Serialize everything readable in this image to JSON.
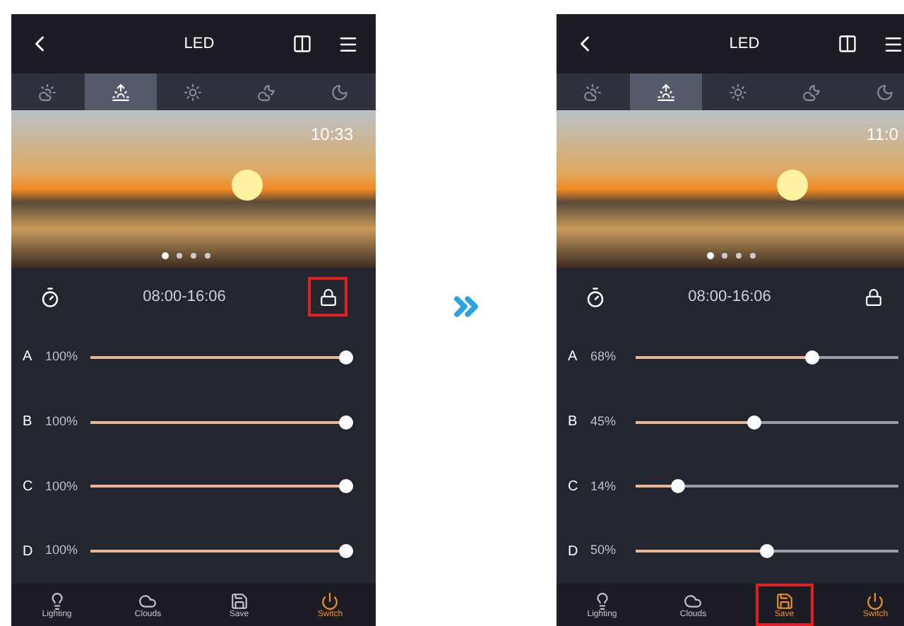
{
  "phones": [
    {
      "title": "LED",
      "modes": [
        {
          "kind": "cloud-sun",
          "selected": false
        },
        {
          "kind": "sunrise",
          "selected": true
        },
        {
          "kind": "sun",
          "selected": false
        },
        {
          "kind": "cloud-moon",
          "selected": false
        },
        {
          "kind": "moon",
          "selected": false
        }
      ],
      "clock": "10:33",
      "schedule": "08:00-16:06",
      "lock_highlighted": true,
      "channels": [
        {
          "name": "A",
          "reading": "100%",
          "level": 1
        },
        {
          "name": "B",
          "reading": "100%",
          "level": 1
        },
        {
          "name": "C",
          "reading": "100%",
          "level": 1
        },
        {
          "name": "D",
          "reading": "100%",
          "level": 1
        }
      ],
      "nav": [
        {
          "kind": "lighting",
          "label": "Lighting",
          "active": false,
          "highlighted": false
        },
        {
          "kind": "clouds",
          "label": "Clouds",
          "active": false,
          "highlighted": false
        },
        {
          "kind": "save",
          "label": "Save",
          "active": false,
          "highlighted": false
        },
        {
          "kind": "switch",
          "label": "Switch",
          "active": true,
          "highlighted": false
        }
      ]
    },
    {
      "title": "LED",
      "modes": [
        {
          "kind": "cloud-sun",
          "selected": false
        },
        {
          "kind": "sunrise",
          "selected": true
        },
        {
          "kind": "sun",
          "selected": false
        },
        {
          "kind": "cloud-moon",
          "selected": false
        },
        {
          "kind": "moon",
          "selected": false
        }
      ],
      "clock": "11:0",
      "schedule": "08:00-16:06",
      "lock_highlighted": false,
      "channels": [
        {
          "name": "A",
          "reading": "68%",
          "level": 0.68
        },
        {
          "name": "B",
          "reading": "45%",
          "level": 0.45
        },
        {
          "name": "C",
          "reading": "14%",
          "level": 0.14
        },
        {
          "name": "D",
          "reading": "50%",
          "level": 0.5
        }
      ],
      "nav": [
        {
          "kind": "lighting",
          "label": "Lighting",
          "active": false,
          "highlighted": false
        },
        {
          "kind": "clouds",
          "label": "Clouds",
          "active": false,
          "highlighted": false
        },
        {
          "kind": "save",
          "label": "Save",
          "active": true,
          "highlighted": true
        },
        {
          "kind": "switch",
          "label": "Switch",
          "active": true,
          "highlighted": false
        }
      ]
    }
  ]
}
